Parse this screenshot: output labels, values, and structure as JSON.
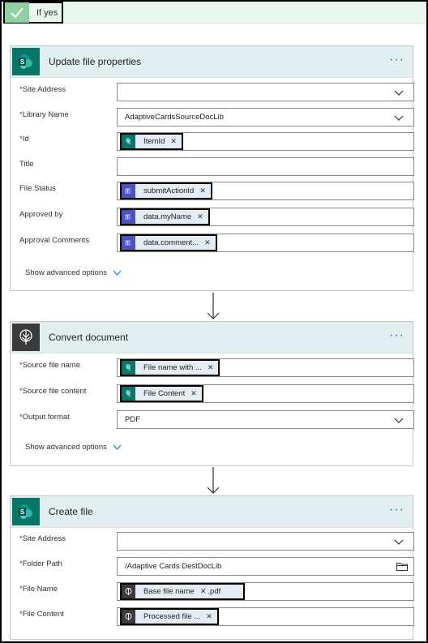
{
  "condition": {
    "label": "If yes"
  },
  "more_label": "···",
  "show_advanced_label": "Show advanced options",
  "cards": [
    {
      "title": "Update file properties",
      "icon": "sharepoint-icon",
      "fields": [
        {
          "label": "Site Address",
          "required": true,
          "value": "",
          "control": "dropdown"
        },
        {
          "label": "Library Name",
          "required": true,
          "value": "AdaptiveCardsSourceDocLib",
          "control": "dropdown"
        },
        {
          "label": "Id",
          "required": true,
          "token": "ItemId",
          "token_icon": "sharepoint-icon"
        },
        {
          "label": "Title",
          "required": false,
          "value": ""
        },
        {
          "label": "File Status",
          "required": false,
          "token": "submitActionId",
          "token_icon": "teams-icon"
        },
        {
          "label": "Approved by",
          "required": false,
          "token": "data.myName",
          "token_icon": "teams-icon"
        },
        {
          "label": "Approval Comments",
          "required": false,
          "token": "data.comment...",
          "token_icon": "teams-icon"
        }
      ]
    },
    {
      "title": "Convert document",
      "icon": "encodian-icon",
      "fields": [
        {
          "label": "Source file name",
          "required": true,
          "token": "File name with ...",
          "token_icon": "sharepoint-icon"
        },
        {
          "label": "Source file content",
          "required": true,
          "token": "File Content",
          "token_icon": "sharepoint-icon"
        },
        {
          "label": "Output format",
          "required": true,
          "value": "PDF",
          "control": "dropdown"
        }
      ]
    },
    {
      "title": "Create file",
      "icon": "sharepoint-icon",
      "fields": [
        {
          "label": "Site Address",
          "required": true,
          "value": "",
          "control": "dropdown"
        },
        {
          "label": "Folder Path",
          "required": true,
          "value": "/Adaptive Cards DestDocLib",
          "control": "folder-picker"
        },
        {
          "label": "File Name",
          "required": true,
          "token": "Base file name",
          "token_icon": "encodian-icon",
          "suffix": ".pdf"
        },
        {
          "label": "File Content",
          "required": true,
          "token": "Processed file ...",
          "token_icon": "encodian-icon"
        }
      ]
    }
  ],
  "colors": {
    "accent": "#0078d4",
    "sharepoint": "#077568",
    "teams": "#4b53bc",
    "encodian": "#3b3b3b",
    "required": "#a4262c",
    "header": "#e1eff1",
    "condition": "#e9f7ee"
  }
}
